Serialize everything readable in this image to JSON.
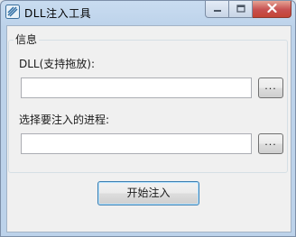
{
  "window": {
    "title": "DLL注入工具"
  },
  "group": {
    "legend": "信息"
  },
  "dll": {
    "label": "DLL(支持拖放):",
    "value": "",
    "browse_label": "..."
  },
  "process": {
    "label": "选择要注入的进程:",
    "value": "",
    "browse_label": "..."
  },
  "actions": {
    "start_label": "开始注入"
  },
  "icons": {
    "app": "app-icon",
    "minimize": "minimize-icon",
    "maximize": "maximize-icon",
    "close": "close-icon"
  },
  "colors": {
    "title_bar": "#bcd2ea",
    "close_button": "#c75050",
    "client_bg": "#f0f0f0"
  }
}
